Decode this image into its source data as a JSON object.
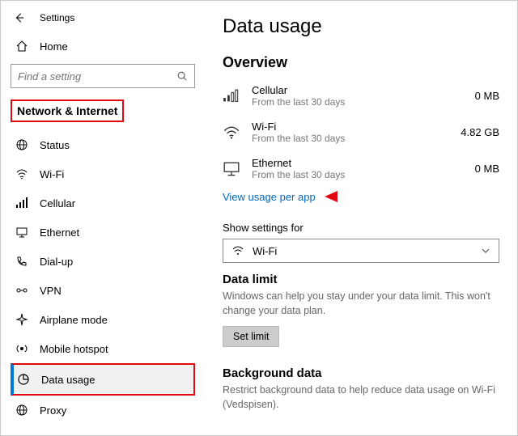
{
  "header": {
    "title": "Settings"
  },
  "sidebar": {
    "home": "Home",
    "search_placeholder": "Find a setting",
    "category": "Network & Internet",
    "items": [
      {
        "label": "Status"
      },
      {
        "label": "Wi-Fi"
      },
      {
        "label": "Cellular"
      },
      {
        "label": "Ethernet"
      },
      {
        "label": "Dial-up"
      },
      {
        "label": "VPN"
      },
      {
        "label": "Airplane mode"
      },
      {
        "label": "Mobile hotspot"
      },
      {
        "label": "Data usage"
      },
      {
        "label": "Proxy"
      }
    ]
  },
  "main": {
    "title": "Data usage",
    "overview": {
      "heading": "Overview",
      "items": [
        {
          "name": "Cellular",
          "sub": "From the last 30 days",
          "value": "0 MB"
        },
        {
          "name": "Wi-Fi",
          "sub": "From the last 30 days",
          "value": "4.82 GB"
        },
        {
          "name": "Ethernet",
          "sub": "From the last 30 days",
          "value": "0 MB"
        }
      ],
      "link": "View usage per app"
    },
    "show_settings": {
      "label": "Show settings for",
      "value": "Wi-Fi"
    },
    "data_limit": {
      "heading": "Data limit",
      "desc": "Windows can help you stay under your data limit. This won't change your data plan.",
      "button": "Set limit"
    },
    "background": {
      "heading": "Background data",
      "desc": "Restrict background data to help reduce data usage on Wi-Fi (Vedspisen)."
    }
  }
}
